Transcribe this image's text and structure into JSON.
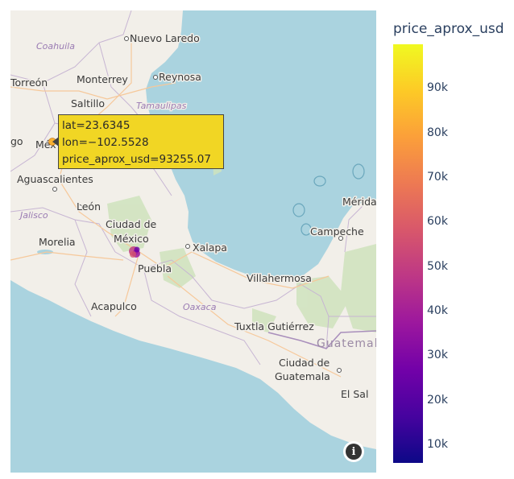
{
  "map": {
    "land_color": "#f2efe9",
    "water_color": "#aad3df",
    "city_labels": [
      "Nuevo Laredo",
      "Torreón",
      "Monterrey",
      "Reynosa",
      "Saltillo",
      "Aguascalientes",
      "León",
      "Ciudad de",
      "México",
      "Morelia",
      "Puebla",
      "Xalapa",
      "Villahermosa",
      "Mérida",
      "Campeche",
      "Acapulco",
      "Tuxtla Gutiérrez",
      "Ciudad de",
      "Guatemala",
      "El Sal",
      "Méx",
      "go"
    ],
    "region_labels": [
      "Coahuila",
      "Tamaulipas",
      "Jalisco",
      "Oaxaca"
    ],
    "country_labels": [
      "Guatemala"
    ]
  },
  "tooltip": {
    "lat": "lat=23.6345",
    "lon": "lon=−102.5528",
    "price": "price_aprox_usd=93255.07"
  },
  "info_icon": "info-icon",
  "chart_data": {
    "type": "scatter",
    "title": "",
    "points": [
      {
        "lat": 23.6345,
        "lon": -102.5528,
        "price_aprox_usd": 93255.07
      },
      {
        "lat": 19.43,
        "lon": -99.13,
        "price_aprox_usd": 52000
      }
    ],
    "colorbar": {
      "title": "price_aprox_usd",
      "tick_labels": [
        "10k",
        "20k",
        "30k",
        "40k",
        "50k",
        "60k",
        "70k",
        "80k",
        "90k"
      ],
      "range": [
        6000,
        100000
      ],
      "colors": [
        "#0d0887",
        "#46039f",
        "#7201a8",
        "#9c179e",
        "#bd3786",
        "#d8576b",
        "#ed7953",
        "#fb9f3a",
        "#fdca26",
        "#f0f921"
      ]
    }
  }
}
